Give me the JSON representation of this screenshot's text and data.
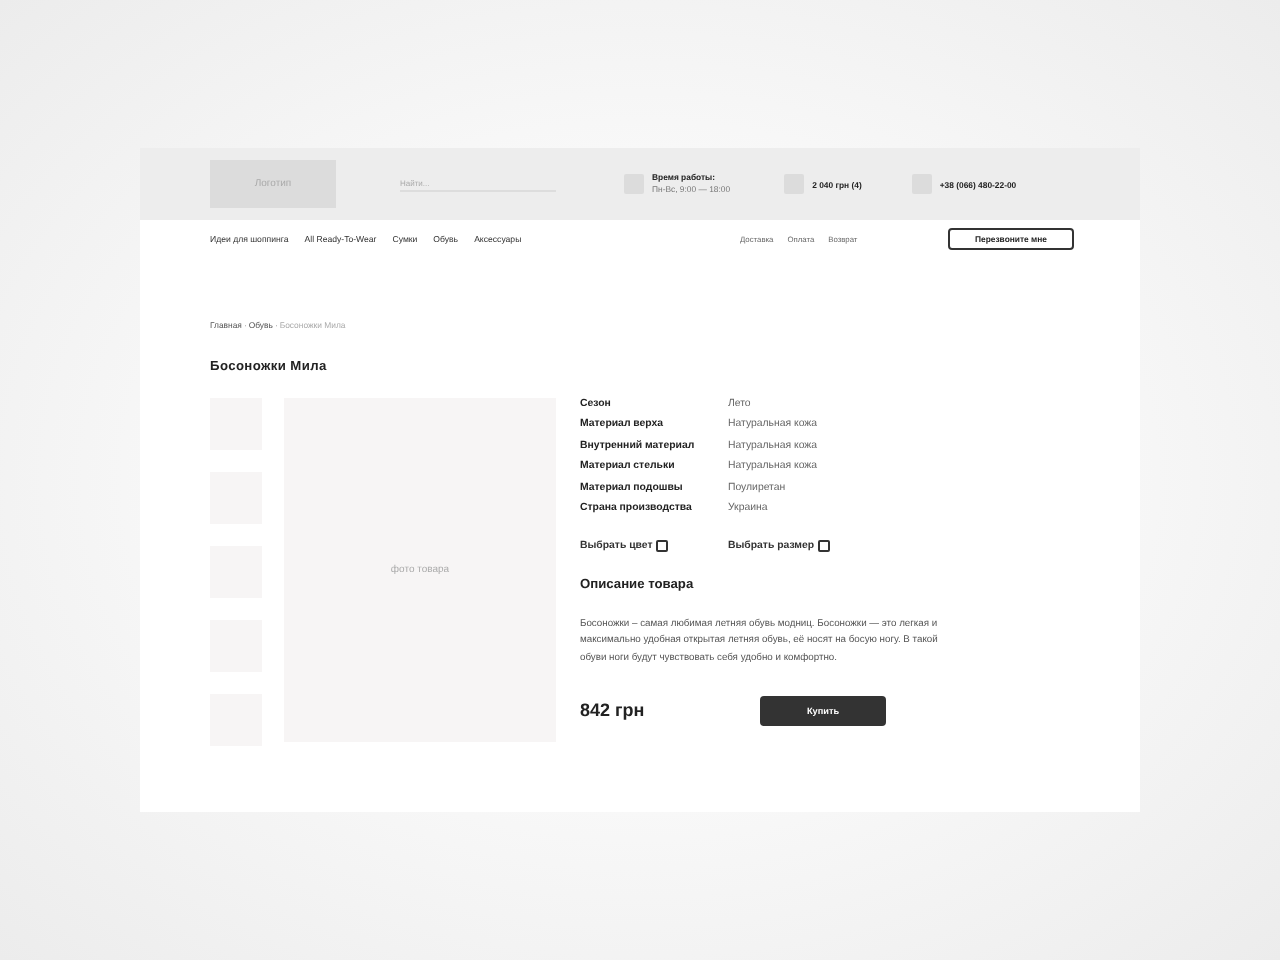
{
  "header": {
    "logo": "Логотип",
    "search": {
      "placeholder": "Найти..."
    },
    "hours": {
      "title": "Время работы:",
      "value": "Пн-Вс, 9:00 — 18:00"
    },
    "cart": "2 040 грн (4)",
    "phone": "+38 (066) 480-22-00"
  },
  "nav": {
    "items": [
      "Идеи для шоппинга",
      "All Ready-To-Wear",
      "Сумки",
      "Обувь",
      "Аксессуары"
    ],
    "links": [
      "Доставка",
      "Оплата",
      "Возврат"
    ],
    "callback": "Перезвоните мне"
  },
  "breadcrumbs": [
    {
      "label": "Главная",
      "current": false
    },
    {
      "separator": "·",
      "label": "Обувь",
      "current": false
    },
    {
      "separator": "·",
      "label": "Босоножки Мила",
      "current": true
    }
  ],
  "product": {
    "title": "Босоножки Мила",
    "thumbnails": [
      {
        "kind": "placeholder"
      },
      {
        "kind": "placeholder"
      },
      {
        "kind": "placeholder"
      },
      {
        "kind": "placeholder"
      },
      {
        "kind": "placeholder"
      }
    ],
    "photo": "фото товара",
    "specs": [
      {
        "name": "Сезон",
        "value": "Лето"
      },
      {
        "name": "Материал верха",
        "value": "Натуральная кожа"
      },
      {
        "name": "Внутренний материал",
        "value": "Натуральная кожа"
      },
      {
        "name": "Материал стельки",
        "value": "Натуральная кожа"
      },
      {
        "name": "Материал подошвы",
        "value": "Поулиретан"
      },
      {
        "name": "Страна производства",
        "value": "Украина"
      }
    ],
    "options": [
      "Выбрать цвет",
      "Выбрать размер"
    ],
    "description_title": "Описание товара",
    "description": "Босоножки – самая любимая летняя обувь модниц. Босоножки — это легкая и максимально удобная открытая летняя обувь, её носят на босую ногу. В такой обуви ноги будут чувствовать себя удобно и комфортно.",
    "price": "842 грн",
    "buy": "Купить"
  }
}
